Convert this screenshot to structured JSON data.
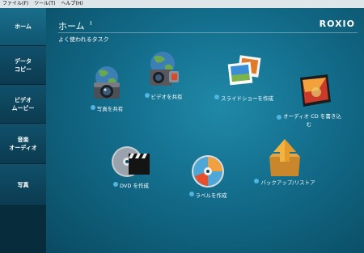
{
  "menu": [
    "ファイル(F)",
    "ツール(T)",
    "ヘルプ(H)"
  ],
  "sidebar": [
    {
      "label": "ホーム",
      "active": true
    },
    {
      "label": "データ\nコピー",
      "active": false
    },
    {
      "label": "ビデオ\nムービー",
      "active": false
    },
    {
      "label": "音楽\nオーディオ",
      "active": false
    },
    {
      "label": "写真",
      "active": false
    }
  ],
  "header": {
    "title": "ホーム",
    "logo": "ROXIO"
  },
  "subtitle": "よく使われるタスク",
  "tasks": [
    {
      "label": "写真を共有",
      "icon": "globe-camera-icon"
    },
    {
      "label": "ビデオを共有",
      "icon": "globe-camcorder-icon"
    },
    {
      "label": "スライドショーを作成",
      "icon": "slideshow-photos-icon"
    },
    {
      "label": "オーディオ CD を書き込む",
      "icon": "audio-cd-icon"
    },
    {
      "label": "DVD を作成",
      "icon": "dvd-clapper-icon"
    },
    {
      "label": "ラベルを作成",
      "icon": "disc-label-icon"
    },
    {
      "label": "バックアップ/リストア",
      "icon": "backup-box-icon"
    }
  ],
  "colors": {
    "accent": "#4fb5e0",
    "background": "#126c8a"
  }
}
